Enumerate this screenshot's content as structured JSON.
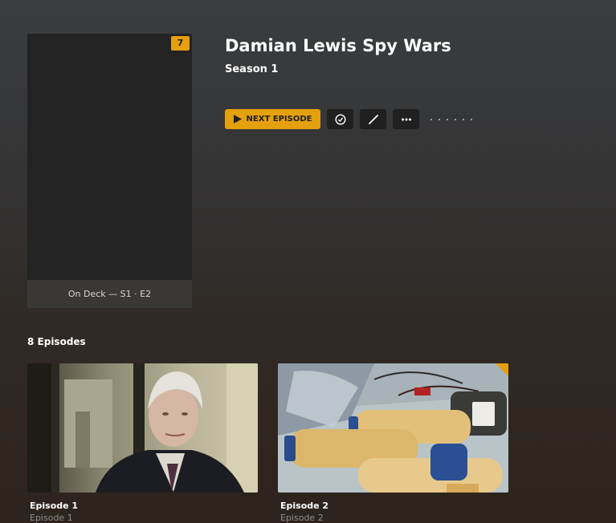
{
  "poster": {
    "badge_count": "7",
    "caption": "On Deck — S1 · E2"
  },
  "show": {
    "title": "Damian Lewis Spy Wars",
    "season": "Season 1"
  },
  "toolbar": {
    "play_label": "NEXT EPISODE",
    "play_icon": "play-icon",
    "mark_watched_icon": "check-circle-icon",
    "edit_icon": "pencil-icon",
    "more_icon": "more-horizontal-icon"
  },
  "episodes": {
    "heading": "8 Episodes",
    "items": [
      {
        "title": "Episode 1",
        "subtitle": "Episode 1"
      },
      {
        "title": "Episode 2",
        "subtitle": "Episode 2"
      }
    ]
  },
  "colors": {
    "accent": "#e5a00d",
    "button_dark": "#202020"
  }
}
